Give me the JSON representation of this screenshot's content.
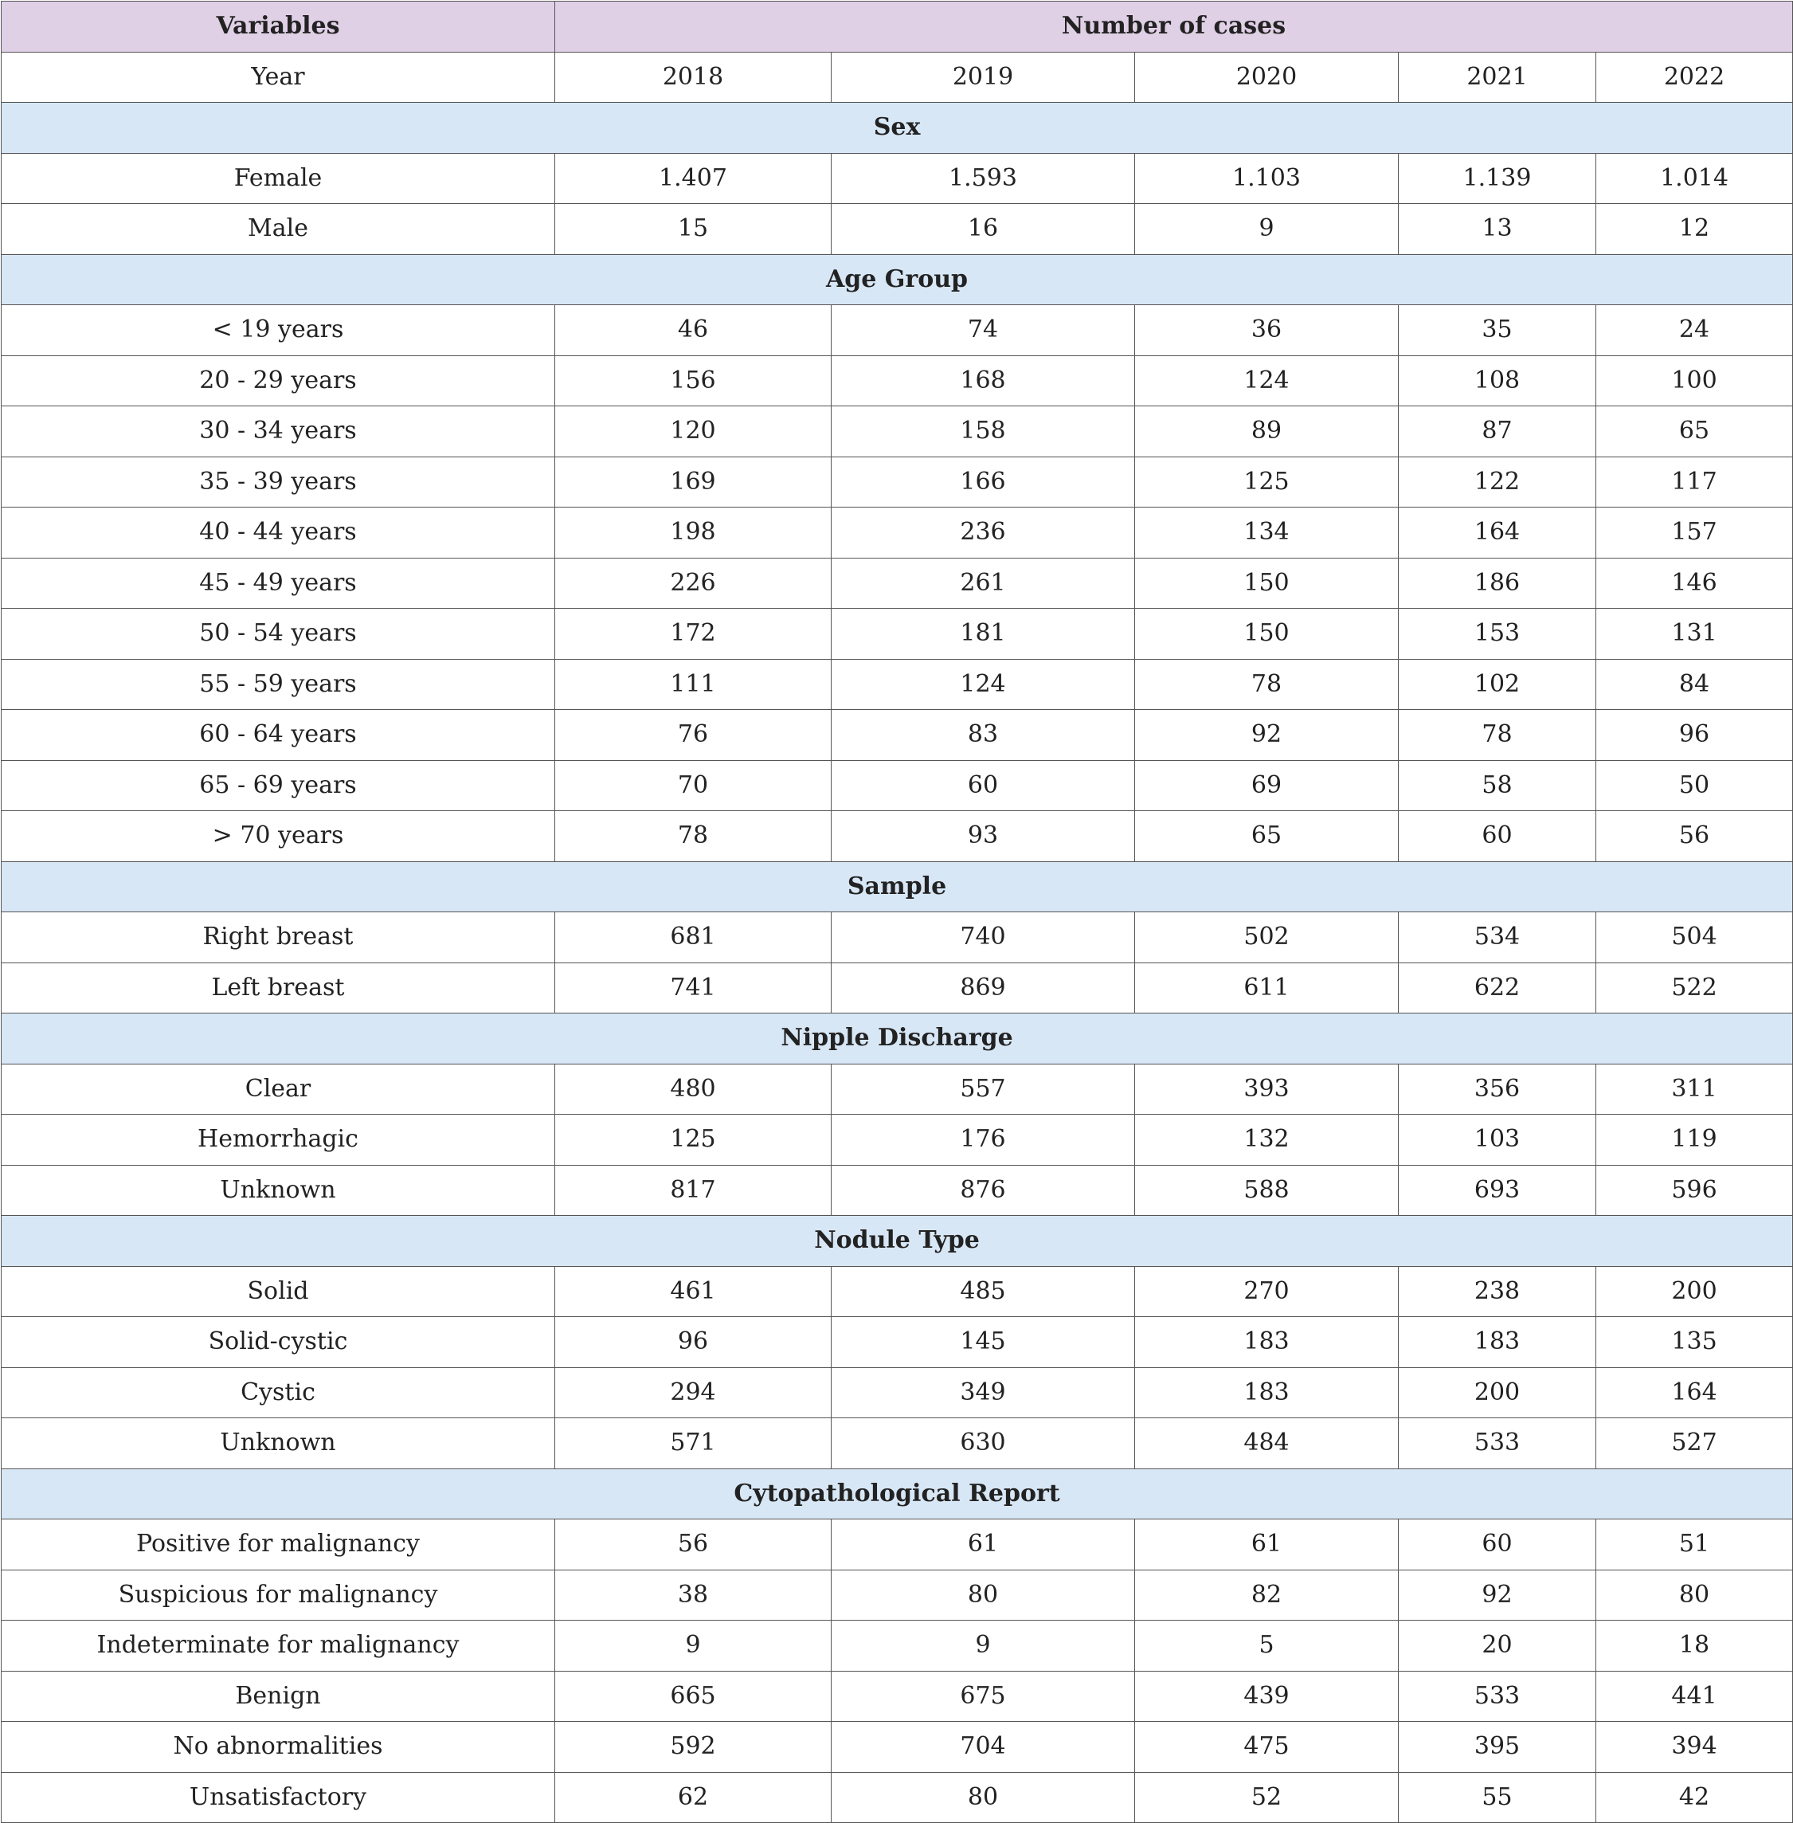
{
  "header": {
    "variables": "Variables",
    "cases": "Number of cases"
  },
  "year_row": {
    "label": "Year",
    "years": [
      "2018",
      "2019",
      "2020",
      "2021",
      "2022"
    ]
  },
  "sections": [
    {
      "title": "Sex",
      "rows": [
        {
          "label": "Female",
          "values": [
            "1.407",
            "1.593",
            "1.103",
            "1.139",
            "1.014"
          ]
        },
        {
          "label": "Male",
          "values": [
            "15",
            "16",
            "9",
            "13",
            "12"
          ]
        }
      ]
    },
    {
      "title": "Age Group",
      "rows": [
        {
          "label": "< 19 years",
          "values": [
            "46",
            "74",
            "36",
            "35",
            "24"
          ]
        },
        {
          "label": "20 - 29 years",
          "values": [
            "156",
            "168",
            "124",
            "108",
            "100"
          ]
        },
        {
          "label": "30 - 34 years",
          "values": [
            "120",
            "158",
            "89",
            "87",
            "65"
          ]
        },
        {
          "label": "35 - 39 years",
          "values": [
            "169",
            "166",
            "125",
            "122",
            "117"
          ]
        },
        {
          "label": "40 - 44 years",
          "values": [
            "198",
            "236",
            "134",
            "164",
            "157"
          ]
        },
        {
          "label": "45 - 49 years",
          "values": [
            "226",
            "261",
            "150",
            "186",
            "146"
          ]
        },
        {
          "label": "50 - 54 years",
          "values": [
            "172",
            "181",
            "150",
            "153",
            "131"
          ]
        },
        {
          "label": "55 - 59 years",
          "values": [
            "111",
            "124",
            "78",
            "102",
            "84"
          ]
        },
        {
          "label": "60 - 64 years",
          "values": [
            "76",
            "83",
            "92",
            "78",
            "96"
          ]
        },
        {
          "label": "65 - 69 years",
          "values": [
            "70",
            "60",
            "69",
            "58",
            "50"
          ]
        },
        {
          "label": "> 70 years",
          "values": [
            "78",
            "93",
            "65",
            "60",
            "56"
          ]
        }
      ]
    },
    {
      "title": "Sample",
      "rows": [
        {
          "label": "Right breast",
          "values": [
            "681",
            "740",
            "502",
            "534",
            "504"
          ]
        },
        {
          "label": "Left breast",
          "values": [
            "741",
            "869",
            "611",
            "622",
            "522"
          ]
        }
      ]
    },
    {
      "title": "Nipple Discharge",
      "rows": [
        {
          "label": "Clear",
          "values": [
            "480",
            "557",
            "393",
            "356",
            "311"
          ]
        },
        {
          "label": "Hemorrhagic",
          "values": [
            "125",
            "176",
            "132",
            "103",
            "119"
          ]
        },
        {
          "label": "Unknown",
          "values": [
            "817",
            "876",
            "588",
            "693",
            "596"
          ]
        }
      ]
    },
    {
      "title": "Nodule Type",
      "rows": [
        {
          "label": "Solid",
          "values": [
            "461",
            "485",
            "270",
            "238",
            "200"
          ]
        },
        {
          "label": "Solid-cystic",
          "values": [
            "96",
            "145",
            "183",
            "183",
            "135"
          ]
        },
        {
          "label": "Cystic",
          "values": [
            "294",
            "349",
            "183",
            "200",
            "164"
          ]
        },
        {
          "label": "Unknown",
          "values": [
            "571",
            "630",
            "484",
            "533",
            "527"
          ]
        }
      ]
    },
    {
      "title": "Cytopathological Report",
      "rows": [
        {
          "label": "Positive for malignancy",
          "values": [
            "56",
            "61",
            "61",
            "60",
            "51"
          ]
        },
        {
          "label": "Suspicious for malignancy",
          "values": [
            "38",
            "80",
            "82",
            "92",
            "80"
          ]
        },
        {
          "label": "Indeterminate for malignancy",
          "values": [
            "9",
            "9",
            "5",
            "20",
            "18"
          ]
        },
        {
          "label": "Benign",
          "values": [
            "665",
            "675",
            "439",
            "533",
            "441"
          ]
        },
        {
          "label": "No abnormalities",
          "values": [
            "592",
            "704",
            "475",
            "395",
            "394"
          ]
        },
        {
          "label": "Unsatisfactory",
          "values": [
            "62",
            "80",
            "52",
            "55",
            "42"
          ]
        }
      ]
    }
  ]
}
